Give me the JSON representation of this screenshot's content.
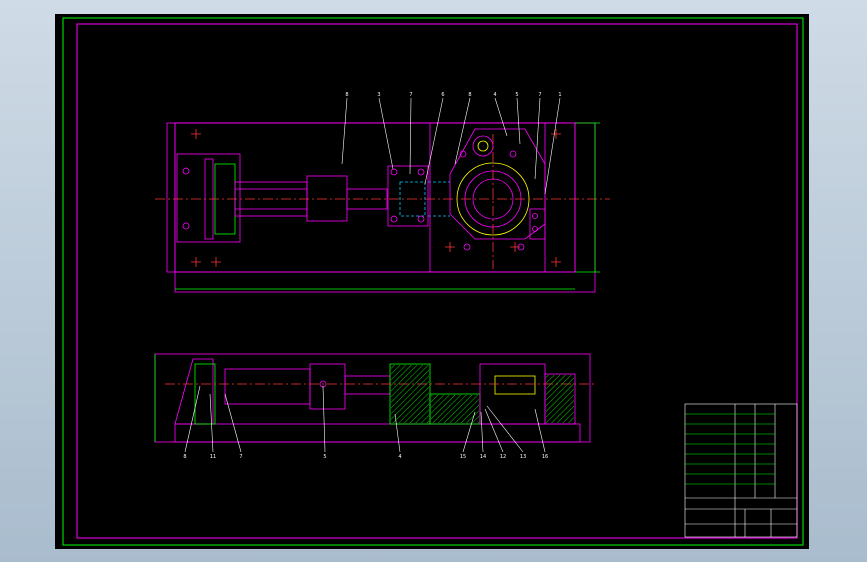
{
  "drawing": {
    "colors": {
      "background": "#000000",
      "outer_border": "#00ff00",
      "inner_border": "#ff00ff",
      "part_outline": "#ff00ff",
      "hatch": "#00ff00",
      "center_line": "#ff3333",
      "dimension": "#00ff00",
      "hidden": "#00ccff",
      "bore": "#ffff00",
      "title_block": "#ffffff"
    },
    "top_view_labels": [
      "8",
      "3",
      "7",
      "6",
      "8",
      "4",
      "5",
      "7",
      "1"
    ],
    "front_view_labels": [
      "8",
      "11",
      "7",
      "5",
      "4",
      "15",
      "14",
      "12",
      "13",
      "16"
    ]
  }
}
